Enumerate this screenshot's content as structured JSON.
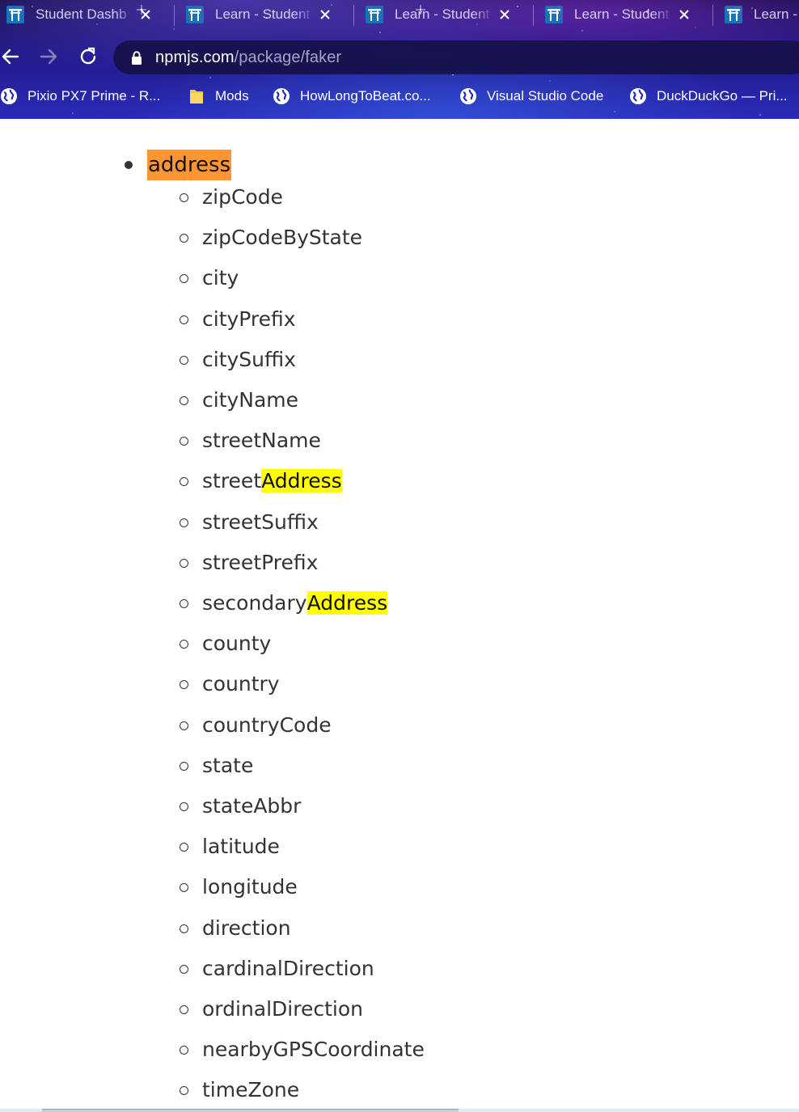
{
  "browser": {
    "tabs": [
      {
        "title": "Student Dashb",
        "icon": "torii-gate-favicon"
      },
      {
        "title": "Learn - Student",
        "icon": "torii-gate-favicon"
      },
      {
        "title": "Learn - Student",
        "icon": "torii-gate-favicon"
      },
      {
        "title": "Learn - Student",
        "icon": "torii-gate-favicon"
      },
      {
        "title": "Learn -",
        "icon": "torii-gate-favicon"
      }
    ],
    "url_host": "npmjs.com",
    "url_path": "/package/faker",
    "bookmarks": [
      {
        "label": "Pixio PX7 Prime - R...",
        "icon": "globe-icon"
      },
      {
        "label": "Mods",
        "icon": "folder-icon"
      },
      {
        "label": "HowLongToBeat.co...",
        "icon": "globe-icon"
      },
      {
        "label": "Visual Studio Code",
        "icon": "globe-icon"
      },
      {
        "label": "DuckDuckGo — Pri...",
        "icon": "globe-icon"
      }
    ]
  },
  "page": {
    "section_label": "address",
    "items": [
      {
        "before": "zipCode",
        "highlight": "",
        "after": ""
      },
      {
        "before": "zipCodeByState",
        "highlight": "",
        "after": ""
      },
      {
        "before": "city",
        "highlight": "",
        "after": ""
      },
      {
        "before": "cityPrefix",
        "highlight": "",
        "after": ""
      },
      {
        "before": "citySuffix",
        "highlight": "",
        "after": ""
      },
      {
        "before": "cityName",
        "highlight": "",
        "after": ""
      },
      {
        "before": "streetName",
        "highlight": "",
        "after": ""
      },
      {
        "before": "street",
        "highlight": "Address",
        "after": ""
      },
      {
        "before": "streetSuffix",
        "highlight": "",
        "after": ""
      },
      {
        "before": "streetPrefix",
        "highlight": "",
        "after": ""
      },
      {
        "before": "secondary",
        "highlight": "Address",
        "after": ""
      },
      {
        "before": "county",
        "highlight": "",
        "after": ""
      },
      {
        "before": "country",
        "highlight": "",
        "after": ""
      },
      {
        "before": "countryCode",
        "highlight": "",
        "after": ""
      },
      {
        "before": "state",
        "highlight": "",
        "after": ""
      },
      {
        "before": "stateAbbr",
        "highlight": "",
        "after": ""
      },
      {
        "before": "latitude",
        "highlight": "",
        "after": ""
      },
      {
        "before": "longitude",
        "highlight": "",
        "after": ""
      },
      {
        "before": "direction",
        "highlight": "",
        "after": ""
      },
      {
        "before": "cardinalDirection",
        "highlight": "",
        "after": ""
      },
      {
        "before": "ordinalDirection",
        "highlight": "",
        "after": ""
      },
      {
        "before": "nearbyGPSCoordinate",
        "highlight": "",
        "after": ""
      },
      {
        "before": "timeZone",
        "highlight": "",
        "after": ""
      }
    ]
  },
  "colors": {
    "find_current_match": "#ff9632",
    "find_other_match": "#ffff00",
    "text": "#333333"
  }
}
